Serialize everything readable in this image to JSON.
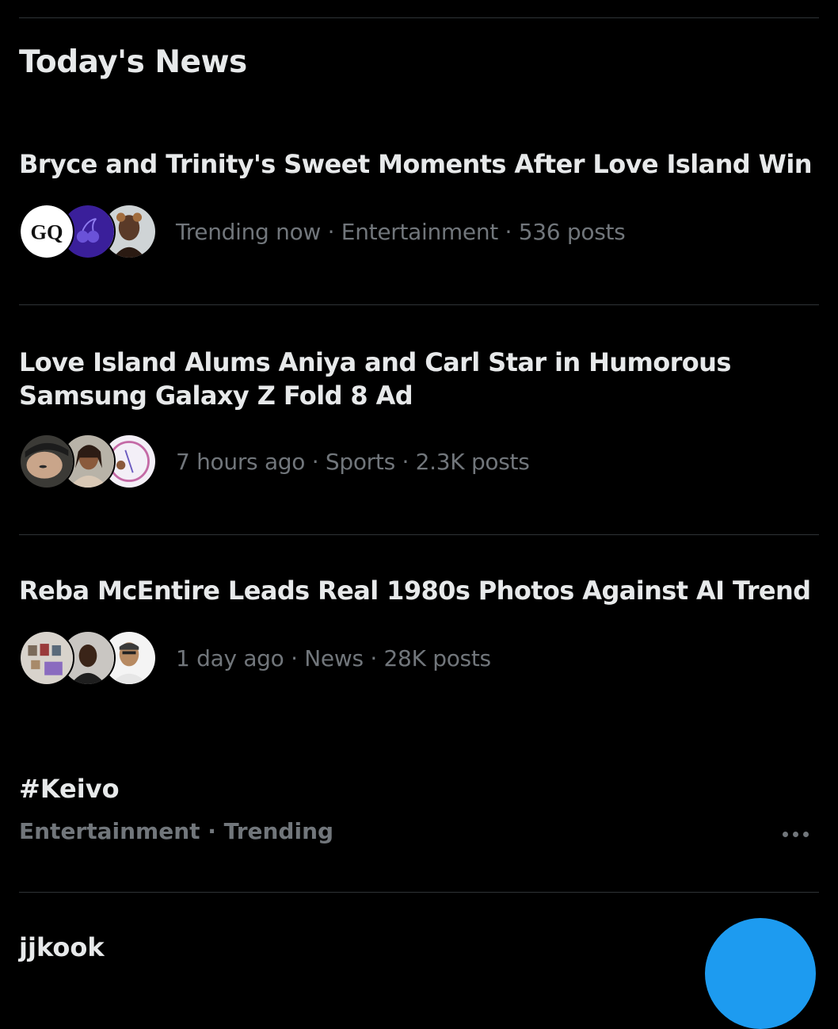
{
  "section": {
    "title": "Today's News"
  },
  "news": [
    {
      "headline": "Bryce and Trinity's Sweet Moments After Love Island Win",
      "meta": "Trending now · Entertainment · 536 posts",
      "avatars": [
        "gq-logo-avatar",
        "cherry-logo-avatar",
        "person-avatar"
      ]
    },
    {
      "headline": "Love Island Alums Aniya and Carl Star in Humorous Samsung Galaxy Z Fold 8 Ad",
      "meta": "7 hours ago · Sports · 2.3K posts",
      "avatars": [
        "person-avatar",
        "person-avatar",
        "birthday-card-avatar"
      ]
    },
    {
      "headline": "Reba McEntire Leads Real 1980s Photos Against AI Trend",
      "meta": "1 day ago · News · 28K posts",
      "avatars": [
        "photo-wall-avatar",
        "person-avatar",
        "person-avatar"
      ]
    }
  ],
  "trend": {
    "tag": "#Keivo",
    "meta": "Entertainment · Trending"
  },
  "next_item_partial": "jjkook",
  "colors": {
    "background": "#000000",
    "text_primary": "#e7e9ea",
    "text_secondary": "#71767b",
    "divider": "#2f3336",
    "accent": "#1d9bf0"
  }
}
